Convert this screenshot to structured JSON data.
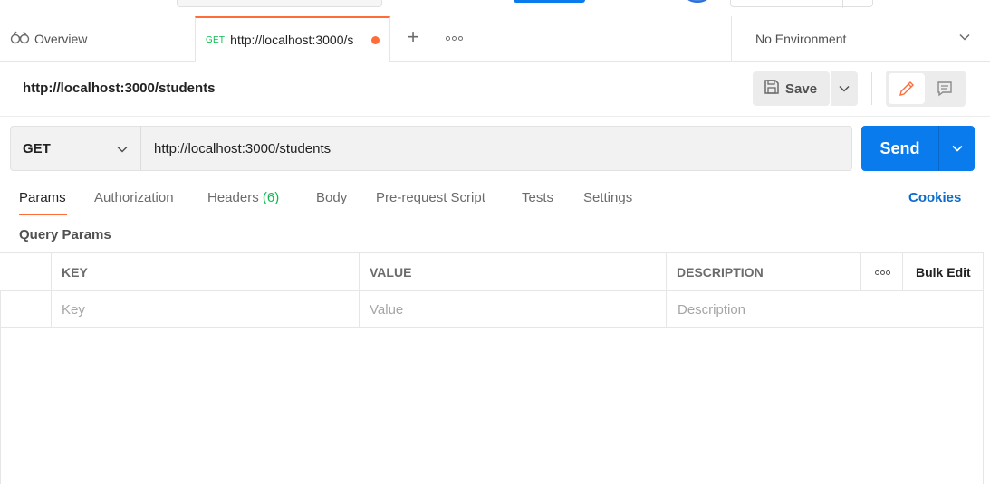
{
  "tabs": {
    "overview_label": "Overview",
    "active_method": "GET",
    "active_url": "http://localhost:3000/s",
    "environment": "No Environment"
  },
  "request": {
    "title": "http://localhost:3000/students",
    "save_label": "Save",
    "method": "GET",
    "url": "http://localhost:3000/students",
    "send_label": "Send"
  },
  "subtabs": {
    "params": "Params",
    "authorization": "Authorization",
    "headers": "Headers",
    "headers_count": "(6)",
    "body": "Body",
    "prerequest": "Pre-request Script",
    "tests": "Tests",
    "settings": "Settings",
    "cookies": "Cookies"
  },
  "params": {
    "title": "Query Params",
    "columns": {
      "key": "KEY",
      "value": "VALUE",
      "description": "DESCRIPTION",
      "bulk_edit": "Bulk Edit"
    },
    "placeholders": {
      "key": "Key",
      "value": "Value",
      "description": "Description"
    }
  },
  "colors": {
    "accent": "#ff6c37",
    "primary": "#097bed",
    "get_method": "#0cbb52",
    "link": "#0b6bcb"
  }
}
